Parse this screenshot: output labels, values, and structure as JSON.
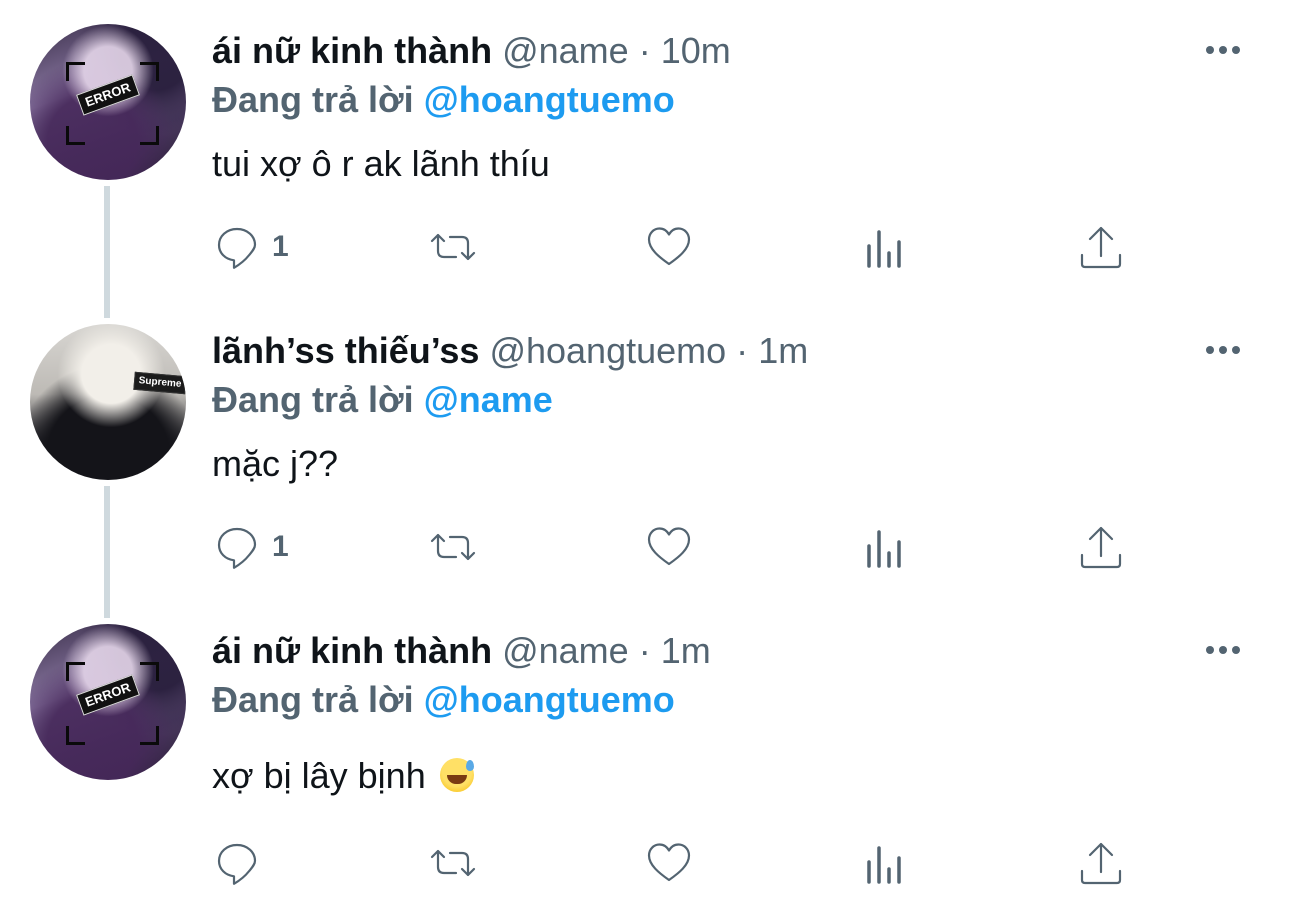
{
  "colors": {
    "name": "#0f1419",
    "secondary": "#536471",
    "mention": "#1d9bf0",
    "thread_line": "#cfd9de"
  },
  "tweets": [
    {
      "display_name": "ái nữ kinh thành",
      "handle": "@name",
      "separator": "·",
      "time": "10m",
      "reply_prefix": "Đang trả lời",
      "reply_to": "@hoangtuemo",
      "text": "tui xợ ô r ak lãnh thíu",
      "reply_count": "1",
      "avatar_badge": "ERROR",
      "emoji": ""
    },
    {
      "display_name": "lãnh’ss thiếu’ss",
      "handle": "@hoangtuemo",
      "separator": "·",
      "time": "1m",
      "reply_prefix": "Đang trả lời",
      "reply_to": "@name",
      "text": "mặc j??",
      "reply_count": "1",
      "avatar_badge": "Supreme",
      "emoji": ""
    },
    {
      "display_name": "ái nữ kinh thành",
      "handle": "@name",
      "separator": "·",
      "time": "1m",
      "reply_prefix": "Đang trả lời",
      "reply_to": "@hoangtuemo",
      "text": "xợ bị lây bịnh",
      "reply_count": "",
      "avatar_badge": "ERROR",
      "emoji": "grinning-face-with-sweat"
    }
  ],
  "icons": {
    "reply": "reply-icon",
    "retweet": "retweet-icon",
    "like": "heart-icon",
    "views": "analytics-icon",
    "share": "share-icon",
    "more": "more-icon"
  }
}
